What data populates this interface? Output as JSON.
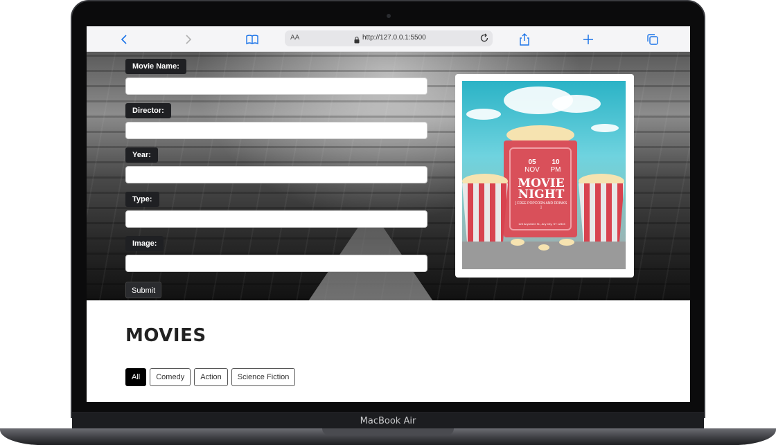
{
  "device": {
    "label": "MacBook Air"
  },
  "browser": {
    "address": {
      "text_size": "AA",
      "url": "http://127.0.0.1:5500"
    },
    "icons": [
      "back-icon",
      "forward-icon",
      "bookmarks-icon",
      "lock-icon",
      "reload-icon",
      "share-icon",
      "new-tab-icon",
      "tabs-icon"
    ]
  },
  "form": {
    "fields": [
      {
        "label": "Movie Name:",
        "value": ""
      },
      {
        "label": "Director:",
        "value": ""
      },
      {
        "label": "Year:",
        "value": ""
      },
      {
        "label": "Type:",
        "value": ""
      },
      {
        "label": "Image:",
        "value": ""
      }
    ],
    "submit_label": "Submit"
  },
  "poster": {
    "day": "05",
    "month": "NOV",
    "hour": "10",
    "period": "PM",
    "title_line1": "MOVIE",
    "title_line2": "NIGHT",
    "subtitle": "[ FREE POPCORN AND DRINKS ]",
    "address": "123 Anywhere St., Any City, ST 12345"
  },
  "movies": {
    "heading": "MOVIES",
    "filters": [
      "All",
      "Comedy",
      "Action",
      "Science Fiction"
    ],
    "active_filter": "All"
  }
}
